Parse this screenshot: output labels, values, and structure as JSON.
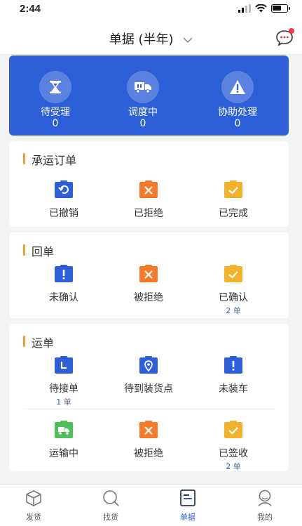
{
  "status_bar": {
    "time": "2:44"
  },
  "header": {
    "title": "单据 (半年)"
  },
  "summary": {
    "items": [
      {
        "label": "待受理",
        "count": "0"
      },
      {
        "label": "调度中",
        "count": "0"
      },
      {
        "label": "协助处理",
        "count": "0"
      }
    ]
  },
  "sections": [
    {
      "title": "承运订单",
      "items": [
        {
          "label": "已撤销",
          "icon": "undo-icon",
          "color": "#2d5fd8"
        },
        {
          "label": "已拒绝",
          "icon": "reject-icon",
          "color": "#f47a2a"
        },
        {
          "label": "已完成",
          "icon": "check-icon",
          "color": "#f3b22c"
        }
      ]
    },
    {
      "title": "回单",
      "items": [
        {
          "label": "未确认",
          "icon": "exclamation-icon",
          "color": "#2d5fd8"
        },
        {
          "label": "被拒绝",
          "icon": "reject-icon",
          "color": "#f47a2a"
        },
        {
          "label": "已确认",
          "count_num": "2",
          "count_unit": "单",
          "icon": "check-icon",
          "color": "#f3b22c"
        }
      ]
    },
    {
      "title": "运单",
      "items": [
        {
          "label": "待接单",
          "count_num": "1",
          "count_unit": "单",
          "icon": "clock-icon",
          "color": "#2d5fd8"
        },
        {
          "label": "待到装货点",
          "icon": "location-icon",
          "color": "#2d5fd8"
        },
        {
          "label": "未装车",
          "icon": "exclamation-icon",
          "color": "#2d5fd8"
        },
        {
          "label": "运输中",
          "icon": "truck-icon",
          "color": "#4fbf5b"
        },
        {
          "label": "被拒绝",
          "icon": "reject-icon",
          "color": "#f47a2a"
        },
        {
          "label": "已签收",
          "count_num": "2",
          "count_unit": "单",
          "icon": "check-icon",
          "color": "#f3b22c"
        }
      ]
    }
  ],
  "tabbar": {
    "items": [
      {
        "label": "发货",
        "icon": "box-icon"
      },
      {
        "label": "找货",
        "icon": "search-icon"
      },
      {
        "label": "单据",
        "icon": "document-icon",
        "active": true
      },
      {
        "label": "我的",
        "icon": "user-icon"
      }
    ]
  }
}
